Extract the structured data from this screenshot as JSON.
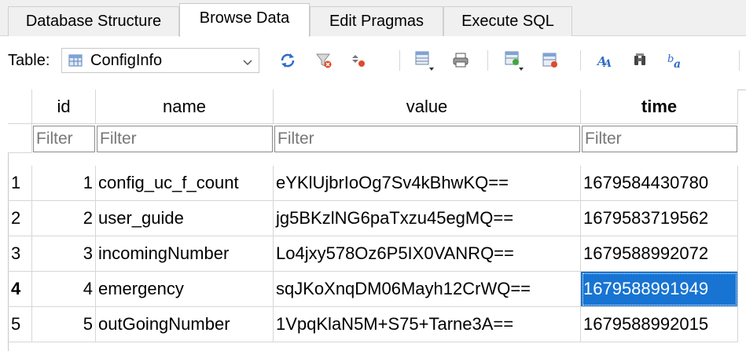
{
  "tabs": [
    {
      "label": "Database Structure",
      "active": false
    },
    {
      "label": "Browse Data",
      "active": true
    },
    {
      "label": "Edit Pragmas",
      "active": false
    },
    {
      "label": "Execute SQL",
      "active": false
    }
  ],
  "toolbar": {
    "table_label": "Table:",
    "selected_table": "ConfigInfo",
    "icons": [
      "table-icon",
      "chevron-down-icon",
      "refresh-icon",
      "clear-filter-icon",
      "sort-order-icon",
      "save-table-icon",
      "print-icon",
      "insert-record-icon",
      "delete-record-icon",
      "find-icon",
      "find-replace-icon",
      "text-format-icon"
    ]
  },
  "grid": {
    "columns": [
      {
        "label": "id",
        "filter_placeholder": "Filter",
        "bold": false
      },
      {
        "label": "name",
        "filter_placeholder": "Filter",
        "bold": false
      },
      {
        "label": "value",
        "filter_placeholder": "Filter",
        "bold": false
      },
      {
        "label": "time",
        "filter_placeholder": "Filter",
        "bold": true
      }
    ],
    "rows": [
      {
        "row_number": "1",
        "id": "1",
        "name": "config_uc_f_count",
        "value": "eYKlUjbrIoOg7Sv4kBhwKQ==",
        "time": "1679584430780"
      },
      {
        "row_number": "2",
        "id": "2",
        "name": "user_guide",
        "value": "jg5BKzlNG6paTxzu45egMQ==",
        "time": "1679583719562"
      },
      {
        "row_number": "3",
        "id": "3",
        "name": "incomingNumber",
        "value": "Lo4jxy578Oz6P5IX0VANRQ==",
        "time": "1679588992072"
      },
      {
        "row_number": "4",
        "id": "4",
        "name": "emergency",
        "value": "sqJKoXnqDM06Mayh12CrWQ==",
        "time": "1679588991949"
      },
      {
        "row_number": "5",
        "id": "5",
        "name": "outGoingNumber",
        "value": "1VpqKlaN5M+S75+Tarne3A==",
        "time": "1679588992015"
      }
    ],
    "selected_row": 4,
    "selected_column": "time",
    "selection_color": "#1874d2"
  }
}
